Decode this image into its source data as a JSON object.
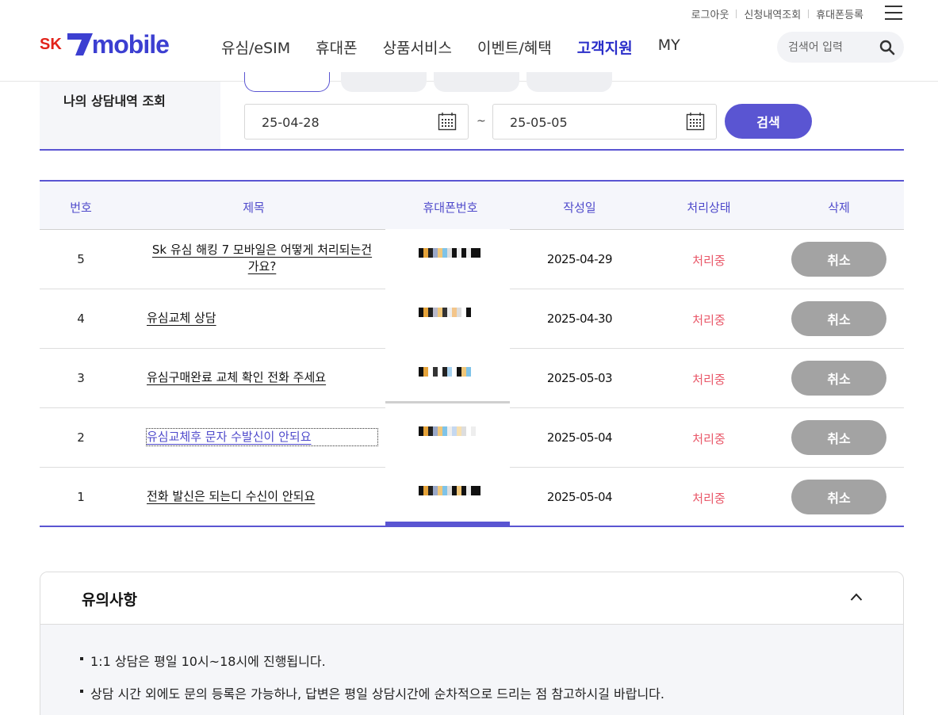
{
  "header": {
    "util_links": [
      "로그아웃",
      "신청내역조회",
      "휴대폰등록"
    ],
    "logo": {
      "sk": "SK",
      "mobile": "mobile"
    },
    "nav": [
      "유심/eSIM",
      "휴대폰",
      "상품서비스",
      "이벤트/혜택",
      "고객지원",
      "MY"
    ],
    "nav_active": "고객지원",
    "search_placeholder": "검색어 입력"
  },
  "filter": {
    "label": "나의 상담내역 조회",
    "start_date": "25-04-28",
    "end_date": "25-05-05",
    "tilde": "~",
    "search_button": "검색"
  },
  "table": {
    "headers": [
      "번호",
      "제목",
      "휴대폰번호",
      "작성일",
      "처리상태",
      "삭제"
    ],
    "rows": [
      {
        "no": "5",
        "title": "Sk 유심 해킹 7 모바일은 어떻게 처리되는건 가요?",
        "date": "2025-04-29",
        "status": "처리중",
        "action": "취소"
      },
      {
        "no": "4",
        "title": "유심교체 상담",
        "date": "2025-04-30",
        "status": "처리중",
        "action": "취소"
      },
      {
        "no": "3",
        "title": "유심구매완료 교체 확인 전화 주세요",
        "date": "2025-05-03",
        "status": "처리중",
        "action": "취소"
      },
      {
        "no": "2",
        "title": "유심교체후 문자 수발신이 안되요",
        "date": "2025-05-04",
        "status": "처리중",
        "action": "취소"
      },
      {
        "no": "1",
        "title": "전화 발신은 되는디 수신이 안되요",
        "date": "2025-05-04",
        "status": "처리중",
        "action": "취소"
      }
    ]
  },
  "notice": {
    "title": "유의사항",
    "items": [
      "1:1 상담은 평일 10시~18시에 진행됩니다.",
      "상담 시간 외에도 문의 등록은 가능하나, 답변은 평일 상담시간에 순차적으로 드리는 점 참고하시길 바랍니다."
    ]
  },
  "colors": {
    "brand": "#3c3fd1",
    "sk_red": "#e2231a",
    "accent": "#5a55d2",
    "status": "#e9596a",
    "cancel_button": "#a3a3a3"
  },
  "icons": [
    "menu-icon",
    "search-icon",
    "calendar-icon",
    "chevron-up-icon"
  ]
}
